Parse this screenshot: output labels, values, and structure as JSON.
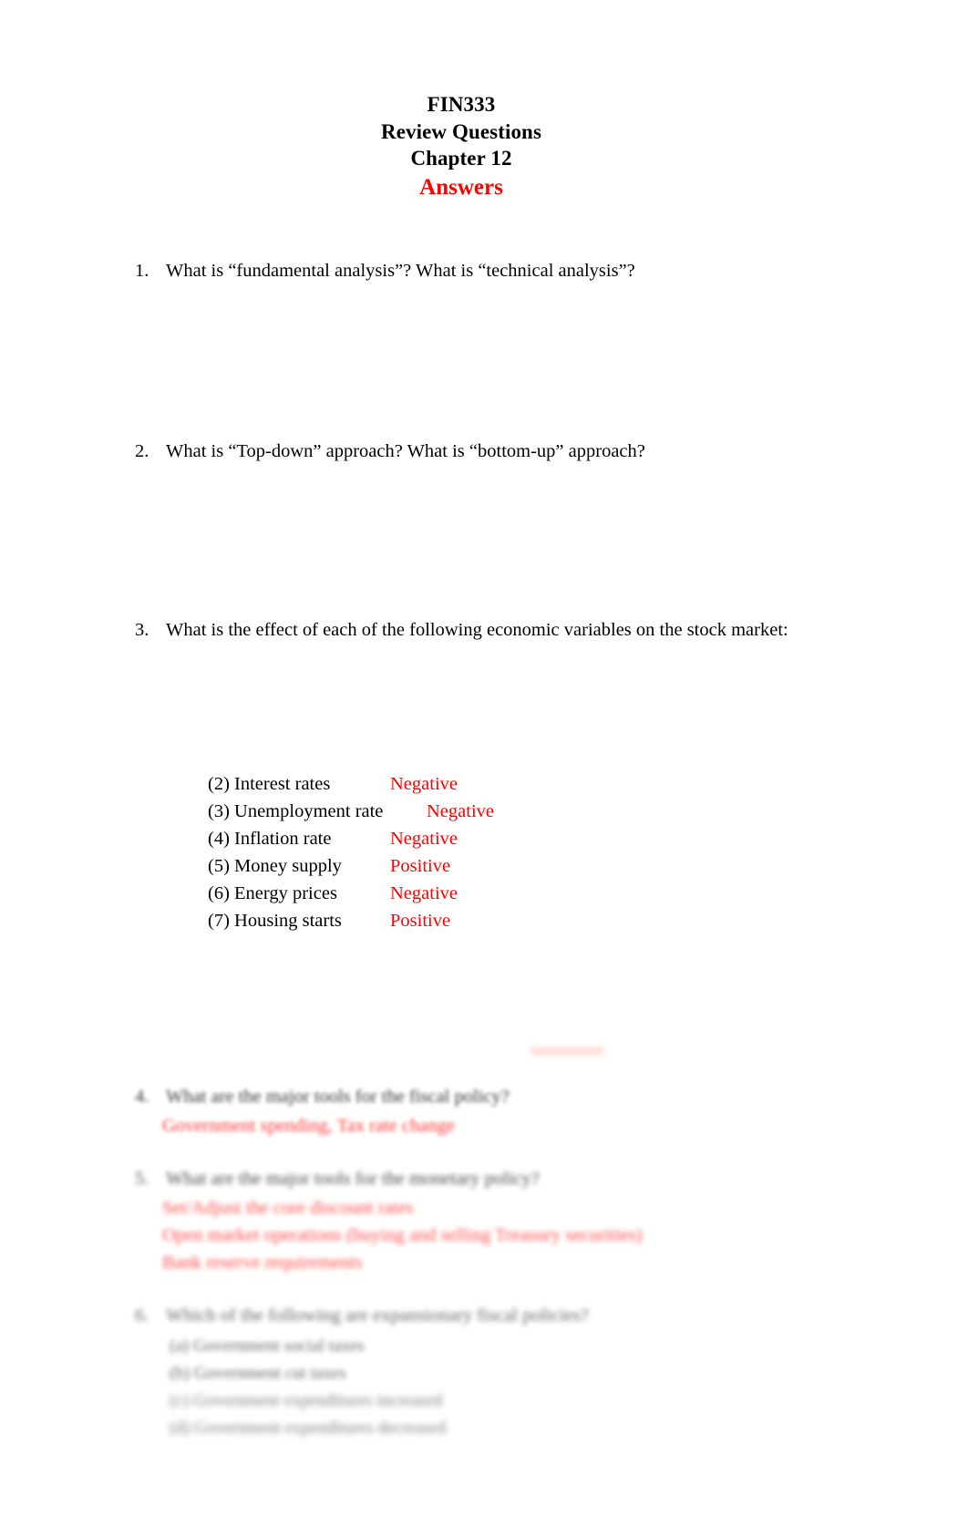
{
  "document": {
    "title_lines": [
      "FIN333",
      "Review Questions",
      "Chapter 12"
    ],
    "answers_heading": "Answers",
    "colors": {
      "answer_red": "#FF0000",
      "body_black": "#000000",
      "page_background": "#FFFFFF"
    }
  },
  "questions": [
    {
      "number": "1.",
      "text": "What is “fundamental analysis”? What is “technical analysis”?"
    },
    {
      "number": "2.",
      "text": "What is “Top-down” approach? What is “bottom-up” approach?"
    },
    {
      "number": "3.",
      "text": "What is the effect of each of the following economic variables on the stock market:"
    },
    {
      "number": "4.",
      "text": "What are the major tools for the fiscal policy?"
    },
    {
      "number": "5.",
      "text": "What are the major tools for the monetary policy?"
    },
    {
      "number": "6.",
      "text": "Which of the following are expansionary fiscal policies?"
    }
  ],
  "economic_variables": [
    {
      "marker": "(2)",
      "label": "Interest rates",
      "effect": "Negative",
      "shifted": false
    },
    {
      "marker": "(3)",
      "label": "Unemployment rate",
      "effect": "Negative",
      "shifted": true
    },
    {
      "marker": "(4)",
      "label": "Inflation rate",
      "effect": "Negative",
      "shifted": false
    },
    {
      "marker": "(5)",
      "label": "Money supply",
      "effect": "Positive",
      "shifted": false
    },
    {
      "marker": "(6)",
      "label": "Energy prices",
      "effect": "Negative",
      "shifted": false
    },
    {
      "marker": "(7)",
      "label": "Housing starts",
      "effect": "Positive",
      "shifted": false
    }
  ],
  "answers": {
    "fiscal_policy": "Government spending, Tax rate change",
    "monetary_policy": [
      "Set/Adjust the core discount rates",
      "Open market operations (buying and selling Treasury securities)",
      "Bank reserve requirements"
    ]
  },
  "sub_options": [
    {
      "marker": "(a)",
      "text": "Government social taxes"
    },
    {
      "marker": "(b)",
      "text": "Government cut taxes"
    },
    {
      "marker": "(c)",
      "text": "Government expenditures increased"
    },
    {
      "marker": "(d)",
      "text": "Government expenditures decreased"
    }
  ]
}
